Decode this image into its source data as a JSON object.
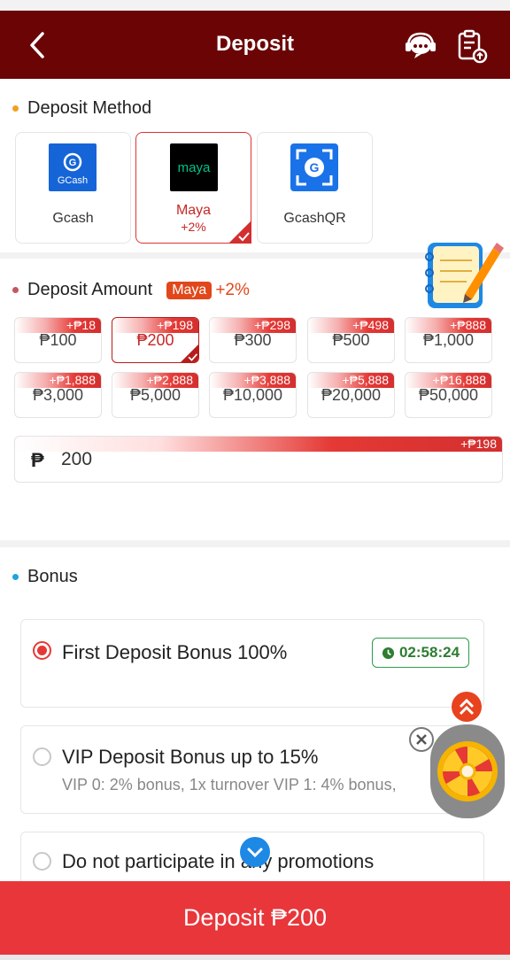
{
  "header": {
    "title": "Deposit",
    "back_icon": "back-arrow-icon",
    "support_icon": "customer-service-icon",
    "records_icon": "deposit-records-icon"
  },
  "method_section": {
    "title": "Deposit Method",
    "methods": [
      {
        "label": "Gcash",
        "sub": "",
        "icon": "gcash-logo",
        "selected": false
      },
      {
        "label": "Maya",
        "sub": "+2%",
        "icon": "maya-logo",
        "selected": true
      },
      {
        "label": "GcashQR",
        "sub": "",
        "icon": "gcashqr-logo",
        "selected": false
      }
    ]
  },
  "amount_section": {
    "title": "Deposit Amount",
    "method_tag": "Maya",
    "method_bonus": "+2%",
    "amounts": [
      {
        "value": "₱100",
        "bonus": "+₱18",
        "selected": false
      },
      {
        "value": "₱200",
        "bonus": "+₱198",
        "selected": true
      },
      {
        "value": "₱300",
        "bonus": "+₱298",
        "selected": false
      },
      {
        "value": "₱500",
        "bonus": "+₱498",
        "selected": false
      },
      {
        "value": "₱1,000",
        "bonus": "+₱888",
        "selected": false
      },
      {
        "value": "₱3,000",
        "bonus": "+₱1,888",
        "selected": false
      },
      {
        "value": "₱5,000",
        "bonus": "+₱2,888",
        "selected": false
      },
      {
        "value": "₱10,000",
        "bonus": "+₱3,888",
        "selected": false
      },
      {
        "value": "₱20,000",
        "bonus": "+₱5,888",
        "selected": false
      },
      {
        "value": "₱50,000",
        "bonus": "+₱16,888",
        "selected": false
      }
    ],
    "input": {
      "currency": "₱",
      "value": "200",
      "bonus": "+₱198"
    }
  },
  "bonus_section": {
    "title": "Bonus",
    "options": [
      {
        "title": "First Deposit Bonus 100%",
        "timer": "02:58:24",
        "selected": true
      },
      {
        "title": "VIP Deposit Bonus up to 15%",
        "desc": "VIP 0: 2% bonus, 1x turnover VIP 1: 4% bonus,",
        "selected": false
      },
      {
        "title": "Do not participate in any promotions",
        "selected": false
      }
    ]
  },
  "footer": {
    "deposit_label": "Deposit ₱200"
  },
  "colors": {
    "header": "#6b0505",
    "accent": "#e53935",
    "button": "#e8363a",
    "timer": "#2e7d32"
  }
}
